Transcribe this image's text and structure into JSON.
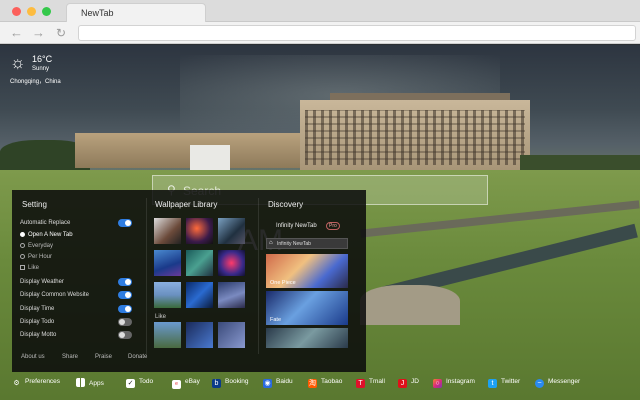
{
  "browser": {
    "tab_title": "NewTab"
  },
  "weather": {
    "temperature": "16°C",
    "condition": "Sunny",
    "city": "Chongqing，China",
    "icon": "sun-icon"
  },
  "search": {
    "placeholder": "Search"
  },
  "clock": {
    "time_fragment": "AM"
  },
  "panel": {
    "setting": {
      "title": "Setting",
      "automatic_replace_label": "Automatic Replace",
      "options": {
        "open_new_tab": "Open A New Tab",
        "everyday": "Everyday",
        "per_hour": "Per Hour",
        "like": "Like"
      },
      "display_weather": "Display Weather",
      "display_common_website": "Display Common Website",
      "display_time": "Display Time",
      "display_todo": "Display Todo",
      "display_motto": "Display Motto"
    },
    "wallpaper_library": {
      "title": "Wallpaper Library",
      "like_label": "Like"
    },
    "discovery": {
      "title": "Discovery",
      "app_name": "Infinity NewTab",
      "badge": "Pro",
      "input_text": "Infinity NewTab",
      "cards": [
        {
          "label": "One Piece"
        },
        {
          "label": "Fate"
        }
      ]
    },
    "footer": {
      "about_us": "About us",
      "share": "Share",
      "praise": "Praise",
      "donate": "Donate"
    }
  },
  "dock": {
    "preferences": "Preferences",
    "apps": "Apps",
    "todo": "Todo",
    "ebay": "eBay",
    "booking": "Booking",
    "baidu": "Baidu",
    "taobao": "Taobao",
    "tmall": "Tmall",
    "jd": "JD",
    "instagram": "Instagram",
    "twitter": "Twitter",
    "messenger": "Messenger"
  },
  "colors": {
    "toggle_on": "#2f7de1",
    "panel_bg": "#0a0a0c"
  }
}
